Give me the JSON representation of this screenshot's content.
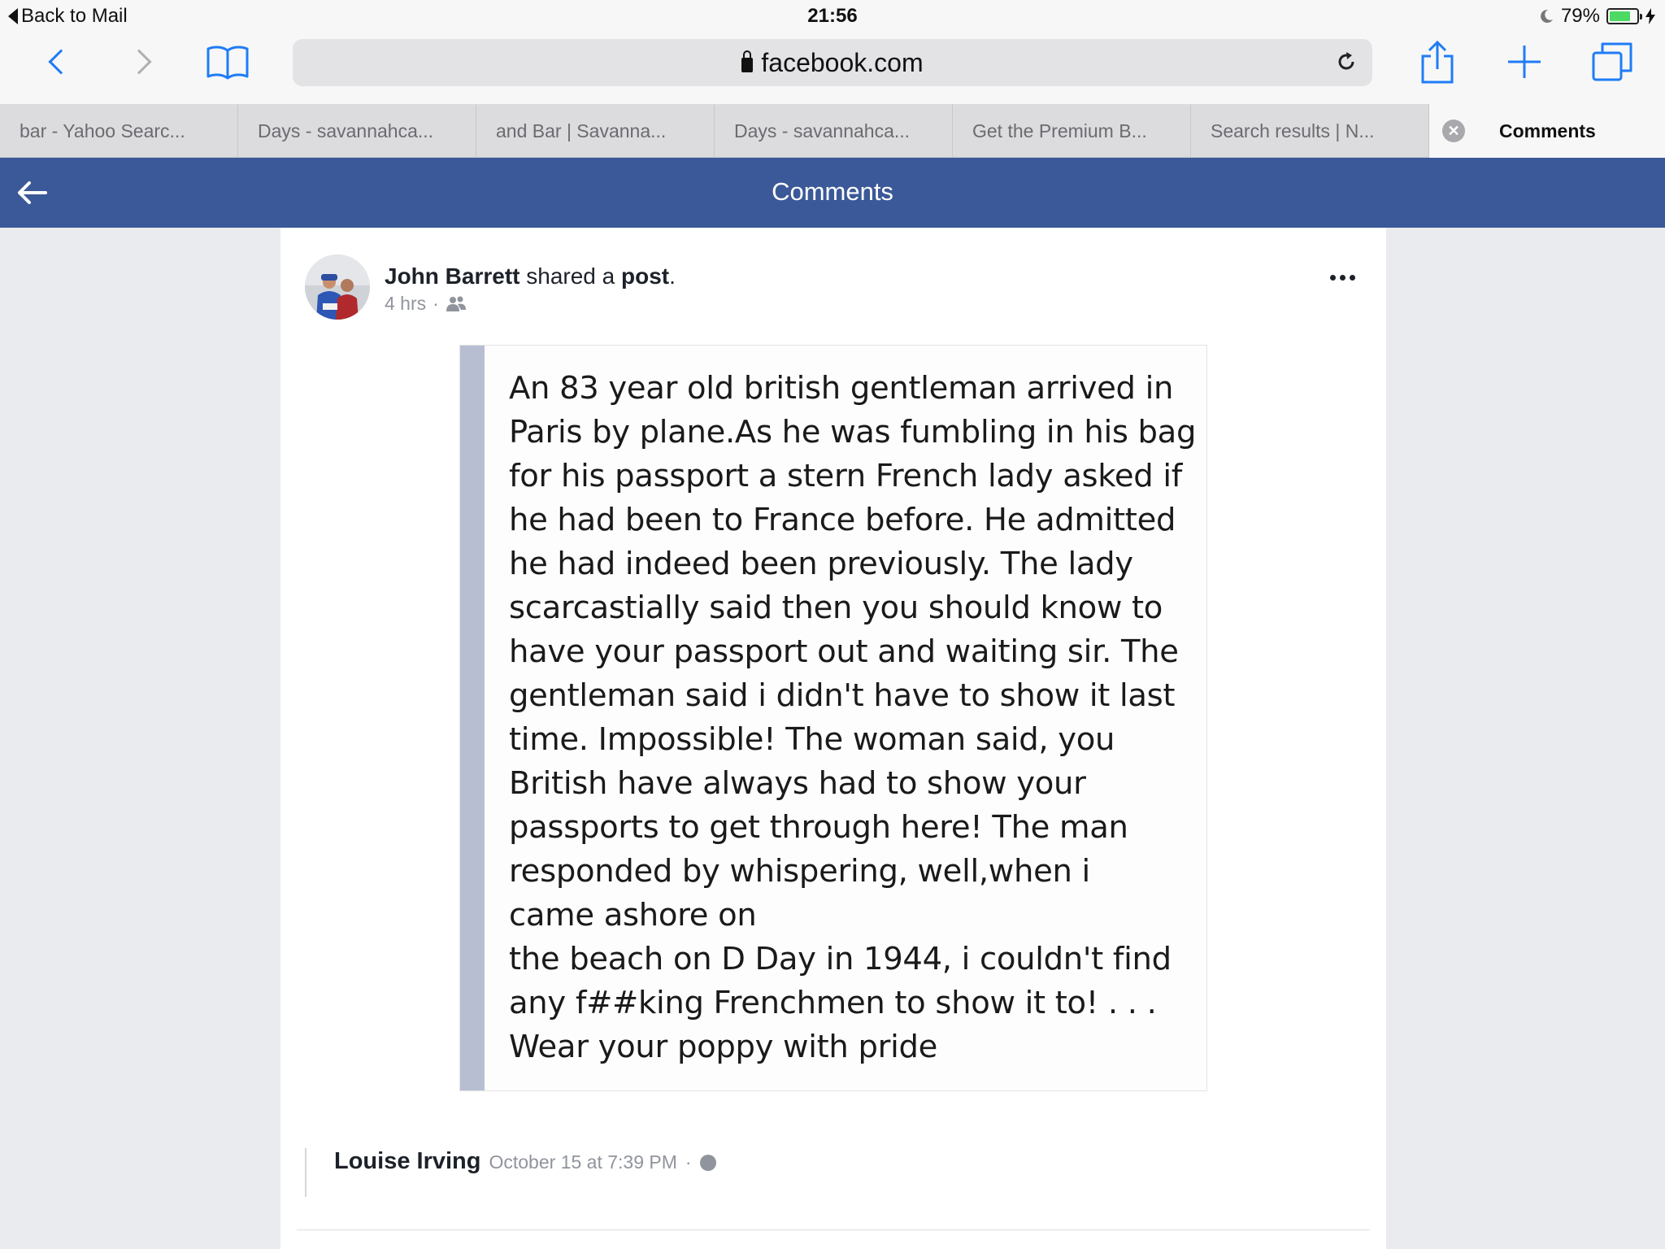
{
  "status_bar": {
    "back_label": "Back to Mail",
    "time": "21:56",
    "battery": "79%",
    "battery_level": 0.79
  },
  "toolbar": {
    "url": "facebook.com"
  },
  "tabs": [
    {
      "label": "bar - Yahoo Searc..."
    },
    {
      "label": "Days - savannahca..."
    },
    {
      "label": "and Bar | Savanna..."
    },
    {
      "label": "Days - savannahca..."
    },
    {
      "label": "Get the Premium B..."
    },
    {
      "label": "Search results | N..."
    },
    {
      "label": "Comments",
      "active": true
    }
  ],
  "header": {
    "title": "Comments"
  },
  "post": {
    "author": "John Barrett",
    "action_text": "shared a",
    "object": "post",
    "period": ".",
    "time": "4 hrs",
    "separator": "·",
    "image_lines": [
      "An 83 year old british gentleman arrived in",
      "Paris by plane.As he was fumbling in his bag",
      "for his passport a stern French lady asked if",
      "he had been to France before. He admitted",
      "he had indeed been previously. The lady",
      "scarcastially said then you should know to",
      "have your passport out and waiting sir. The",
      "gentleman said i didn't have to show it last",
      "time. Impossible! The woman said, you",
      "British have always had to show your",
      "passports to get through here! The man",
      "responded by whispering, well,when i",
      "came ashore on",
      "the beach on D Day in 1944, i couldn't find",
      "any f##king Frenchmen to show it to! . . .",
      "Wear your poppy with pride"
    ]
  },
  "comment": {
    "author": "Louise Irving",
    "time": "October 15 at 7:39 PM",
    "separator": "·"
  },
  "colors": {
    "facebook_blue": "#3b5998",
    "ios_blue": "#1f7cf6",
    "battery_green": "#4cd964"
  }
}
